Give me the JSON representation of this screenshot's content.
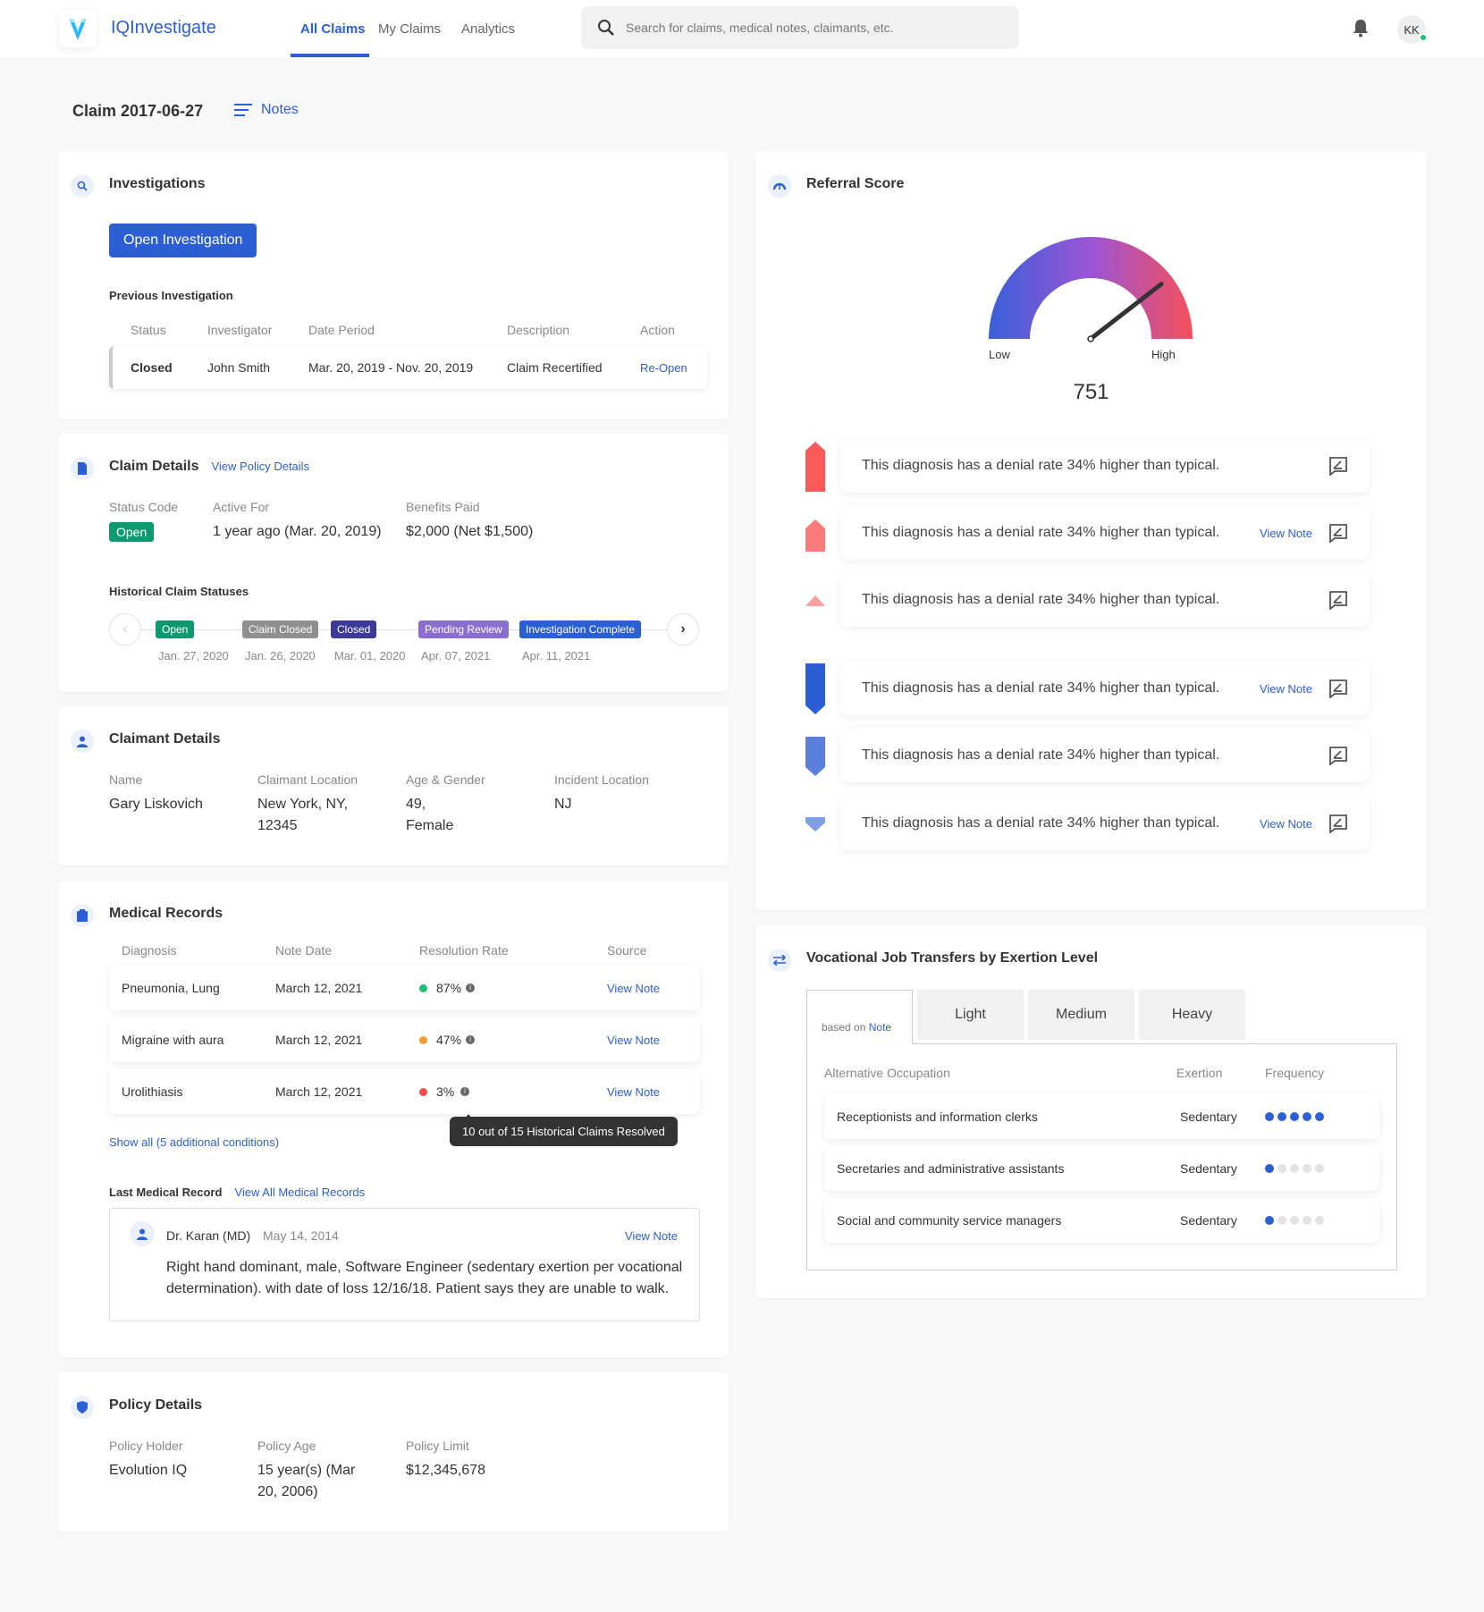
{
  "header": {
    "brand": "IQInvestigate",
    "nav": [
      "All Claims",
      "My Claims",
      "Analytics"
    ],
    "search_placeholder": "Search for claims, medical notes, claimants, etc.",
    "avatar": "KK"
  },
  "page": {
    "title": "Claim 2017-06-27",
    "notes_label": "Notes"
  },
  "investigations": {
    "title": "Investigations",
    "open_button": "Open Investigation",
    "previous_label": "Previous Investigation",
    "columns": [
      "Status",
      "Investigator",
      "Date Period",
      "Description",
      "Action"
    ],
    "row": {
      "status": "Closed",
      "investigator": "John Smith",
      "period": "Mar. 20, 2019 - Nov. 20, 2019",
      "description": "Claim Recertified",
      "action": "Re-Open"
    }
  },
  "claim_details": {
    "title": "Claim Details",
    "policy_link": "View Policy Details",
    "status_code_label": "Status Code",
    "status_code": "Open",
    "active_for_label": "Active For",
    "active_for": "1 year ago (Mar. 20, 2019)",
    "benefits_label": "Benefits Paid",
    "benefits": "$2,000 (Net $1,500)",
    "history_label": "Historical Claim Statuses",
    "history": [
      {
        "status": "Open",
        "date": "Jan. 27, 2020",
        "color": "#0e9a6e"
      },
      {
        "status": "Claim Closed",
        "date": "Jan. 26, 2020",
        "color": "#8f8f8f"
      },
      {
        "status": "Closed",
        "date": "Mar. 01, 2020",
        "color": "#3b3a96"
      },
      {
        "status": "Pending Review",
        "date": "Apr. 07, 2021",
        "color": "#8a6fce"
      },
      {
        "status": "Investigation Complete",
        "date": "Apr. 11, 2021",
        "color": "#2d5fd4"
      }
    ]
  },
  "claimant": {
    "title": "Claimant Details",
    "fields": [
      {
        "label": "Name",
        "value": "Gary Liskovich"
      },
      {
        "label": "Claimant Location",
        "value": "New York, NY, 12345"
      },
      {
        "label": "Age & Gender",
        "value": "49, Female"
      },
      {
        "label": "Incident Location",
        "value": "NJ"
      }
    ]
  },
  "medical": {
    "title": "Medical Records",
    "columns": [
      "Diagnosis",
      "Note Date",
      "Resolution Rate",
      "Source"
    ],
    "rows": [
      {
        "diagnosis": "Pneumonia, Lung",
        "date": "March 12, 2021",
        "rate": "87%",
        "color": "#1fbf75",
        "source": "View Note"
      },
      {
        "diagnosis": "Migraine with aura",
        "date": "March 12, 2021",
        "rate": "47%",
        "color": "#f39c32",
        "source": "View Note"
      },
      {
        "diagnosis": "Urolithiasis",
        "date": "March 12, 2021",
        "rate": "3%",
        "color": "#f04a4a",
        "source": "View Note"
      }
    ],
    "tooltip": "10 out of 15 Historical Claims Resolved",
    "show_all": "Show all (5 additional conditions)",
    "last_label": "Last Medical Record",
    "view_all": "View All Medical Records",
    "last": {
      "doctor": "Dr. Karan (MD)",
      "date": "May 14, 2014",
      "link": "View Note",
      "text": "Right hand dominant, male, Software Engineer (sedentary exertion per vocational determination). with date of loss 12/16/18. Patient says they are unable to walk."
    }
  },
  "policy": {
    "title": "Policy Details",
    "fields": [
      {
        "label": "Policy Holder",
        "value": "Evolution IQ"
      },
      {
        "label": "Policy Age",
        "value": "15 year(s) (Mar 20, 2006)"
      },
      {
        "label": "Policy Limit",
        "value": "$12,345,678"
      }
    ]
  },
  "referral": {
    "title": "Referral Score",
    "low": "Low",
    "high": "High",
    "score": "751",
    "score_fraction": 0.79,
    "factors": [
      {
        "text": "This diagnosis has a denial rate 34% higher than typical.",
        "link": null,
        "color": "#f85a5a"
      },
      {
        "text": "This diagnosis has a denial rate 34% higher than typical.",
        "link": "View Note",
        "color": "#fa7b7b"
      },
      {
        "text": "This diagnosis has a denial rate 34% higher than typical.",
        "link": null,
        "color": "#fb9f9f"
      },
      {
        "text": "This diagnosis has a denial rate 34% higher than typical.",
        "link": "View Note",
        "color": "#2d5fd4"
      },
      {
        "text": "This diagnosis has a denial rate 34% higher than typical.",
        "link": null,
        "color": "#5a80dc"
      },
      {
        "text": "This diagnosis has a denial rate 34% higher than typical.",
        "link": "View Note",
        "color": "#7f9fe6"
      }
    ]
  },
  "vocational": {
    "title": "Vocational Job Transfers by Exertion Level",
    "based_on": "based on",
    "note": "Note",
    "tabs": [
      "Light",
      "Medium",
      "Heavy"
    ],
    "columns": [
      "Alternative Occupation",
      "Exertion",
      "Frequency"
    ],
    "rows": [
      {
        "occupation": "Receptionists and information clerks",
        "exertion": "Sedentary",
        "frequency": 5
      },
      {
        "occupation": "Secretaries and administrative assistants",
        "exertion": "Sedentary",
        "frequency": 1
      },
      {
        "occupation": "Social and community service managers",
        "exertion": "Sedentary",
        "frequency": 1
      }
    ]
  }
}
